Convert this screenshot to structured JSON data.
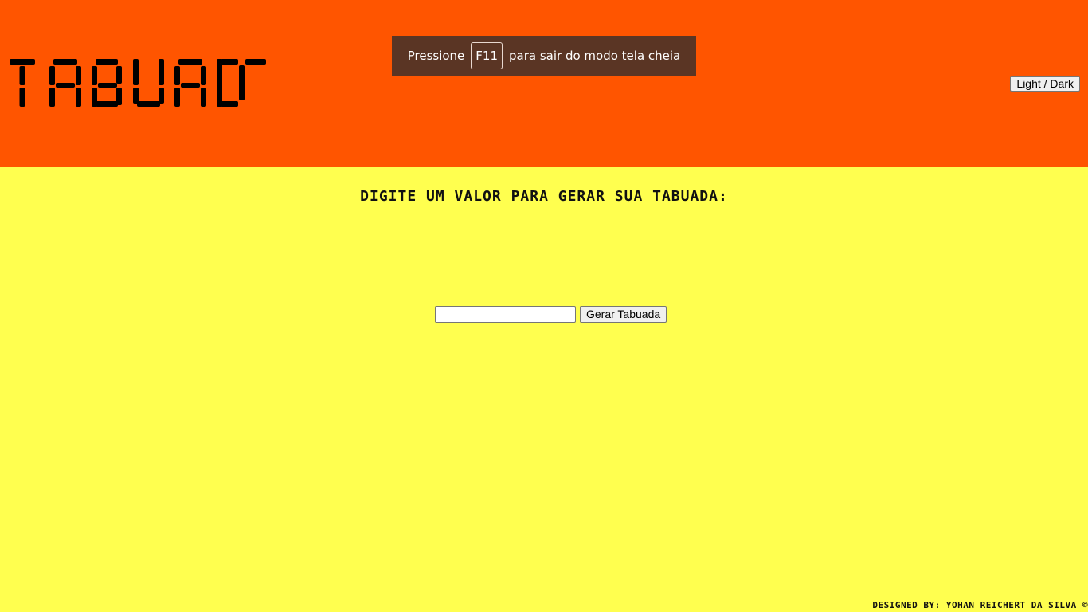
{
  "header": {
    "logo_text": "TABUADA",
    "background_color": "#ff5500"
  },
  "fullscreen_toast": {
    "prefix": "Pressione",
    "key": "F11",
    "suffix": "para sair do modo tela cheia"
  },
  "theme_toggle": {
    "label": "Light / Dark"
  },
  "main": {
    "background_color": "#ffff4f",
    "prompt": "DIGITE UM VALOR PARA GERAR SUA TABUADA:",
    "input": {
      "value": "",
      "placeholder": ""
    },
    "generate_button_label": "Gerar Tabuada"
  },
  "footer": {
    "credit": "DESIGNED BY: YOHAN REICHERT DA SILVA ©"
  }
}
